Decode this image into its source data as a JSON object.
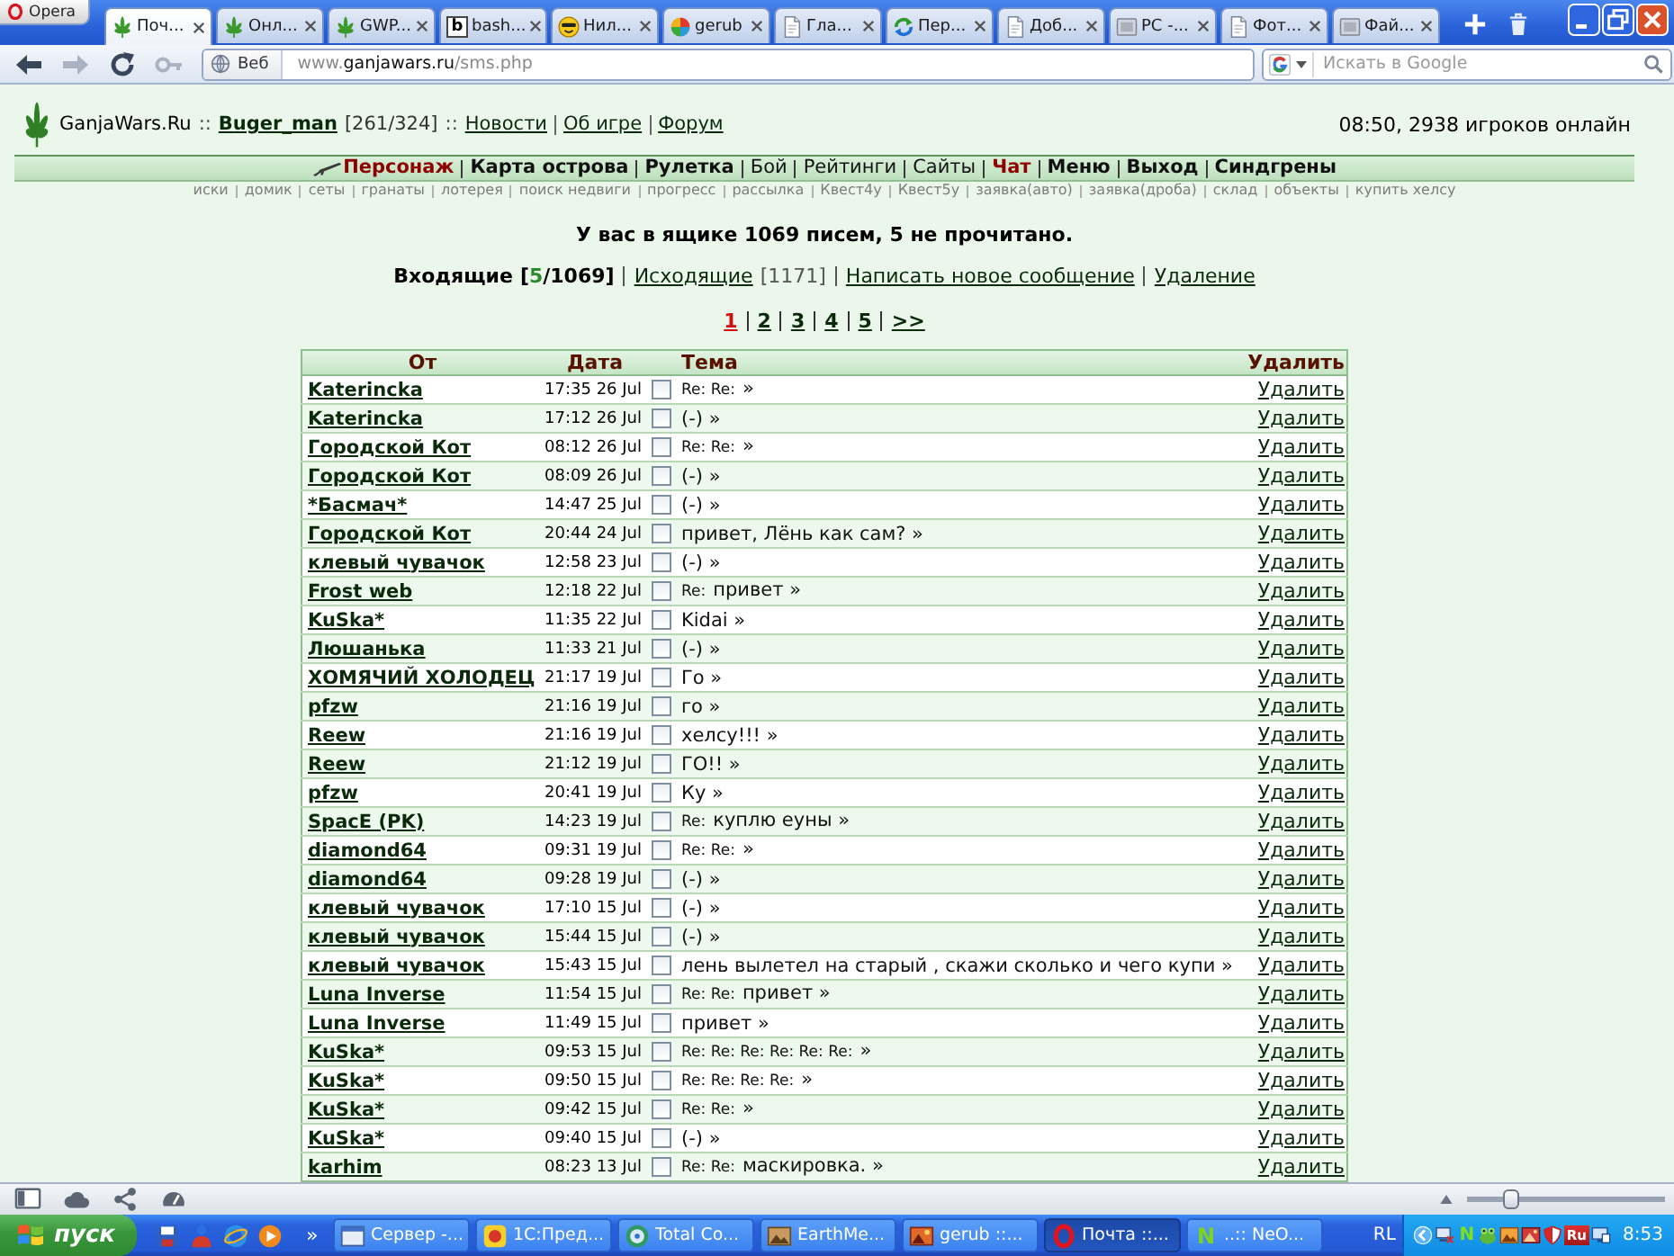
{
  "browser": {
    "menu_button": "Opera",
    "tabs": [
      {
        "title": "Поч...",
        "kind": "leaf",
        "selected": true
      },
      {
        "title": "Онл...",
        "kind": "leaf",
        "selected": false
      },
      {
        "title": "GWP...",
        "kind": "leaf",
        "selected": false
      },
      {
        "title": "bash...",
        "kind": "letter",
        "glyph": "b",
        "selected": false
      },
      {
        "title": "Нил...",
        "kind": "smiley",
        "selected": false
      },
      {
        "title": "gerub",
        "kind": "pinwheel",
        "selected": false
      },
      {
        "title": "Гла...",
        "kind": "page",
        "selected": false
      },
      {
        "title": "Пер...",
        "kind": "arrows",
        "selected": false
      },
      {
        "title": "Доб...",
        "kind": "page",
        "selected": false
      },
      {
        "title": "PC -...",
        "kind": "frame",
        "selected": false
      },
      {
        "title": "Фот...",
        "kind": "page",
        "selected": false
      },
      {
        "title": "Фай...",
        "kind": "frame",
        "selected": false
      }
    ],
    "toolbar": [
      {
        "kind": "back",
        "disabled": false
      },
      {
        "kind": "forward",
        "disabled": true
      },
      {
        "kind": "reload",
        "disabled": false
      },
      {
        "kind": "key",
        "disabled": true
      }
    ],
    "address_bar": {
      "badge": "Веб",
      "url_parts": [
        {
          "text": "www.",
          "kind": "dim"
        },
        {
          "text": "ganjawars.ru",
          "kind": "domain"
        },
        {
          "text": "/sms.php",
          "kind": "dim"
        }
      ]
    },
    "search_field": {
      "placeholder": "Искать в Google"
    }
  },
  "page": {
    "site_header": {
      "parts": [
        {
          "kind": "site",
          "text": "GanjaWars.Ru"
        },
        {
          "kind": "separator",
          "text": "::"
        },
        {
          "kind": "user",
          "text": "Buger_man"
        },
        {
          "kind": "stats",
          "text": "[261/324]"
        },
        {
          "kind": "separator",
          "text": "::"
        }
      ],
      "links": [
        "Новости",
        "Об игре",
        "Форум"
      ],
      "online": "08:50, 2938 игроков онлайн"
    },
    "main_menu": [
      {
        "label": "Персонаж",
        "kind": "current"
      },
      {
        "label": "Карта острова",
        "kind": "bold"
      },
      {
        "label": "Рулетка",
        "kind": "bold"
      },
      {
        "label": "Бой",
        "kind": "plain"
      },
      {
        "label": "Рейтинги",
        "kind": "plain"
      },
      {
        "label": "Сайты",
        "kind": "plain"
      },
      {
        "label": "Чат",
        "kind": "alert"
      },
      {
        "label": "Меню",
        "kind": "bold"
      },
      {
        "label": "Выход",
        "kind": "bold"
      },
      {
        "label": "Синдгрены",
        "kind": "bold"
      }
    ],
    "sub_menu": [
      "иски",
      "домик",
      "сеты",
      "гранаты",
      "лотерея",
      "поиск недвиги",
      "прогресс",
      "рассылка",
      "Квест4у",
      "Квест5у",
      "заявка(авто)",
      "заявка(дроба)",
      "склад",
      "объекты",
      "купить хелсу"
    ],
    "mailbox_summary": "У вас в ящике 1069 писем, 5 не прочитано.",
    "folders": [
      {
        "label": "Входящие",
        "selected": true,
        "count_parts": [
          {
            "text": "[",
            "kind": "plain"
          },
          {
            "text": "5",
            "kind": "unread"
          },
          {
            "text": "/1069]",
            "kind": "plain"
          }
        ]
      },
      {
        "label": "Исходящие",
        "selected": false,
        "count_parts": [
          {
            "text": "[1171]",
            "kind": "plain"
          }
        ]
      },
      {
        "label": "Написать новое сообщение",
        "selected": false
      },
      {
        "label": "Удаление",
        "selected": false
      }
    ],
    "pages": [
      {
        "label": "1",
        "selected": true
      },
      {
        "label": "2",
        "selected": false
      },
      {
        "label": "3",
        "selected": false
      },
      {
        "label": "4",
        "selected": false
      },
      {
        "label": "5",
        "selected": false
      },
      {
        "label": ">>",
        "selected": false
      }
    ],
    "messages": {
      "columns": [
        "От",
        "Дата",
        "Тема",
        "Удалить"
      ],
      "rows": [
        {
          "from": "Katerincka",
          "date": "17:35 26 Jul",
          "checked": false,
          "prefix": "Re: Re:",
          "subject": "»",
          "action": "Удалить"
        },
        {
          "from": "Katerincka",
          "date": "17:12 26 Jul",
          "checked": false,
          "subject": "(-) »",
          "action": "Удалить"
        },
        {
          "from": "Городской Кот",
          "date": "08:12 26 Jul",
          "checked": false,
          "prefix": "Re: Re:",
          "subject": "»",
          "action": "Удалить"
        },
        {
          "from": "Городской Кот",
          "date": "08:09 26 Jul",
          "checked": false,
          "subject": "(-) »",
          "action": "Удалить"
        },
        {
          "from": "*Басмач*",
          "date": "14:47 25 Jul",
          "checked": false,
          "subject": "(-) »",
          "action": "Удалить"
        },
        {
          "from": "Городской Кот",
          "date": "20:44 24 Jul",
          "checked": false,
          "subject": "привет, Лёнь как сам? »",
          "action": "Удалить"
        },
        {
          "from": "клевый чувачок",
          "date": "12:58 23 Jul",
          "checked": false,
          "subject": "(-) »",
          "action": "Удалить"
        },
        {
          "from": "Frost web",
          "date": "12:18 22 Jul",
          "checked": false,
          "prefix": "Re:",
          "subject": "привет »",
          "action": "Удалить"
        },
        {
          "from": "KuSka*",
          "date": "11:35 22 Jul",
          "checked": false,
          "subject": "Kidai »",
          "action": "Удалить"
        },
        {
          "from": "Люшанька",
          "date": "11:33 21 Jul",
          "checked": false,
          "subject": "(-) »",
          "action": "Удалить"
        },
        {
          "from": "ХОМЯЧИЙ ХОЛОДЕЦ",
          "date": "21:17 19 Jul",
          "checked": false,
          "subject": "Го »",
          "action": "Удалить"
        },
        {
          "from": "pfzw",
          "date": "21:16 19 Jul",
          "checked": false,
          "subject": "го »",
          "action": "Удалить"
        },
        {
          "from": "Reew",
          "date": "21:16 19 Jul",
          "checked": false,
          "subject": "хелсу!!! »",
          "action": "Удалить"
        },
        {
          "from": "Reew",
          "date": "21:12 19 Jul",
          "checked": false,
          "subject": "ГО!! »",
          "action": "Удалить"
        },
        {
          "from": "pfzw",
          "date": "20:41 19 Jul",
          "checked": false,
          "subject": "Ку »",
          "action": "Удалить"
        },
        {
          "from": "SpacE (PK)",
          "date": "14:23 19 Jul",
          "checked": false,
          "prefix": "Re:",
          "subject": "куплю еуны »",
          "action": "Удалить"
        },
        {
          "from": "diamond64",
          "date": "09:31 19 Jul",
          "checked": false,
          "prefix": "Re: Re:",
          "subject": "»",
          "action": "Удалить"
        },
        {
          "from": "diamond64",
          "date": "09:28 19 Jul",
          "checked": false,
          "subject": "(-) »",
          "action": "Удалить"
        },
        {
          "from": "клевый чувачок",
          "date": "17:10 15 Jul",
          "checked": false,
          "subject": "(-) »",
          "action": "Удалить"
        },
        {
          "from": "клевый чувачок",
          "date": "15:44 15 Jul",
          "checked": false,
          "subject": "(-) »",
          "action": "Удалить"
        },
        {
          "from": "клевый чувачок",
          "date": "15:43 15 Jul",
          "checked": false,
          "subject": "лень вылетел на старый , скажи сколько и чего купи »",
          "action": "Удалить"
        },
        {
          "from": "Luna Inverse",
          "date": "11:54 15 Jul",
          "checked": false,
          "prefix": "Re: Re:",
          "subject": "привет »",
          "action": "Удалить"
        },
        {
          "from": "Luna Inverse",
          "date": "11:49 15 Jul",
          "checked": false,
          "subject": "привет »",
          "action": "Удалить"
        },
        {
          "from": "KuSka*",
          "date": "09:53 15 Jul",
          "checked": false,
          "prefix": "Re: Re: Re: Re: Re: Re:",
          "subject": "»",
          "action": "Удалить"
        },
        {
          "from": "KuSka*",
          "date": "09:50 15 Jul",
          "checked": false,
          "prefix": "Re: Re: Re: Re:",
          "subject": "»",
          "action": "Удалить"
        },
        {
          "from": "KuSka*",
          "date": "09:42 15 Jul",
          "checked": false,
          "prefix": "Re: Re:",
          "subject": "»",
          "action": "Удалить"
        },
        {
          "from": "KuSka*",
          "date": "09:40 15 Jul",
          "checked": false,
          "subject": "(-) »",
          "action": "Удалить"
        },
        {
          "from": "karhim",
          "date": "08:23 13 Jul",
          "checked": false,
          "prefix": "Re: Re:",
          "subject": "маскировка. »",
          "action": "Удалить"
        }
      ]
    }
  },
  "status_bar": {
    "zoom_slider": {
      "level": 0.2
    }
  },
  "taskbar": {
    "start": "пуск",
    "quick_launch_more": "»",
    "tasks": [
      {
        "label": "Сервер -...",
        "kind": "window",
        "selected": false
      },
      {
        "label": "1С:Пред...",
        "kind": "app",
        "selected": false
      },
      {
        "label": "Total Co...",
        "kind": "disk",
        "selected": false
      },
      {
        "label": "EarthMe...",
        "kind": "picture",
        "selected": false
      },
      {
        "label": "gerub ::...",
        "kind": "photo",
        "selected": false
      },
      {
        "label": "Почта ::...",
        "kind": "ring",
        "selected": true
      },
      {
        "label": "..:: NeO...",
        "kind": "letter",
        "glyph": "N",
        "selected": false
      }
    ],
    "language": "RL",
    "tray": [
      {
        "kind": "chevron"
      },
      {
        "kind": "computer"
      },
      {
        "kind": "letter",
        "text": "N"
      },
      {
        "kind": "bug"
      },
      {
        "kind": "picture"
      },
      {
        "kind": "photo"
      },
      {
        "kind": "shield"
      },
      {
        "kind": "lang",
        "text": "Ru"
      },
      {
        "kind": "monitor"
      }
    ],
    "clock": "8:53"
  }
}
